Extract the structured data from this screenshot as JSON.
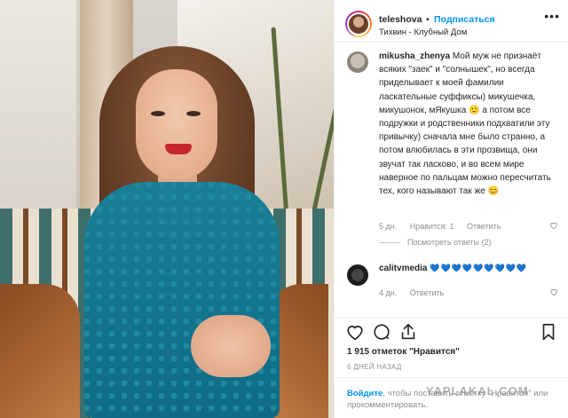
{
  "header": {
    "username": "teleshova",
    "dot": "•",
    "follow_label": "Подписаться",
    "location": "Тихвин - Клубный Дом",
    "more": "•••"
  },
  "comments": [
    {
      "username": "mikusha_zhenya",
      "text": "Мой муж не признаёт всяких \"заек\" и \"солнышек\", но всегда приделывает к моей фамилии ласкательные суффиксы) микушечка, микушонок, мЯкушка 🙂 а потом все подружки и родственники подхватили эту привычку) сначала мне было странно, а потом влюбилась в эти прозвища, они звучат так ласково, и во всем мире наверное по пальцам можно пересчитать тех, кого называют так же 😊",
      "time": "5 дн.",
      "likes": "Нравится: 1",
      "reply": "Ответить",
      "view_replies": "Посмотреть ответы (2)"
    },
    {
      "username": "calitvmedia",
      "text": "💙💙💙💙💙💙💙💙💙",
      "time": "4 дн.",
      "reply": "Ответить"
    }
  ],
  "actions": {
    "like_icon": "heart-icon",
    "comment_icon": "comment-icon",
    "share_icon": "share-icon",
    "save_icon": "bookmark-icon"
  },
  "stats": {
    "likes": "1 915 отметок \"Нравится\"",
    "time_ago": "6 ДНЕЙ НАЗАД"
  },
  "login": {
    "link": "Войдите",
    "text": ", чтобы поставить отметку \"Нравится\" или прокомментировать."
  },
  "watermark": "YAPLAKAL.COM",
  "colors": {
    "accent": "#0095f6",
    "dress": "#0f6b84"
  }
}
